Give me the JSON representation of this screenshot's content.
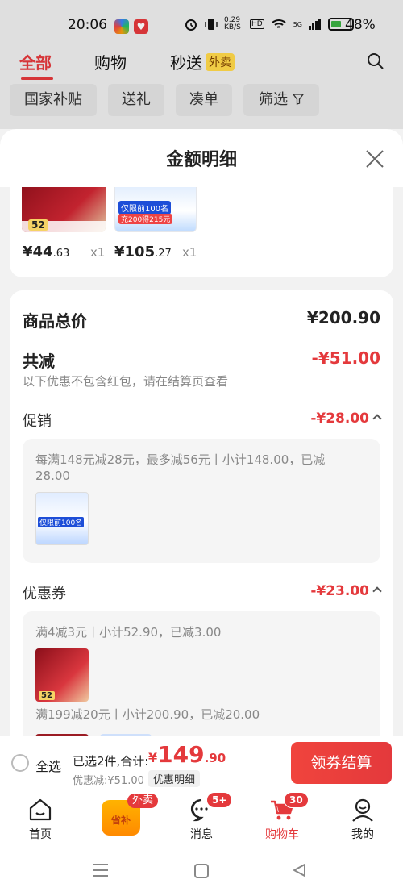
{
  "status_bar": {
    "time": "20:06",
    "network_speed": "0.29 KB/S",
    "hd": "HD",
    "signal": "5G",
    "battery_percent": "48%"
  },
  "header": {
    "tabs": [
      {
        "label": "全部",
        "active": true
      },
      {
        "label": "购物",
        "active": false
      },
      {
        "label": "秒送",
        "active": false,
        "badge": "外卖"
      }
    ],
    "filters": [
      "国家补贴",
      "送礼",
      "凑单",
      "筛选"
    ]
  },
  "sheet": {
    "title": "金额明细",
    "products": [
      {
        "price_int": "¥44",
        "price_dec": ".63",
        "qty": "x1",
        "badge": "52"
      },
      {
        "price_int": "¥105",
        "price_dec": ".27",
        "qty": "x1",
        "tag": "仅限前100名",
        "sub": "充200得215元"
      }
    ],
    "total_label": "商品总价",
    "total_value": "¥200.90",
    "reduce_label": "共减",
    "reduce_value": "-¥51.00",
    "reduce_note": "以下优惠不包含红包，请在结算页查看",
    "promo": {
      "label": "促销",
      "value": "-¥28.00",
      "line1": "每满148元减28元，最多减56元丨小计148.00，已减",
      "line2": "28.00",
      "thumb_tag": "仅限前100名"
    },
    "coupon": {
      "label": "优惠券",
      "value": "-¥23.00",
      "line1": "满4减3元丨小计52.90，已减3.00",
      "thumb_badge": "52",
      "line2": "满199减20元丨小计200.90，已减20.00"
    }
  },
  "checkout": {
    "select_all": "全选",
    "summary": "已选2件,合计:",
    "currency": "¥",
    "total_int": "149",
    "total_dec": ".90",
    "discount": "优惠减:¥51.00",
    "detail_button": "优惠明细",
    "checkout_button": "领券结算"
  },
  "bottom_nav": {
    "items": [
      {
        "label": "首页",
        "icon": "home-icon"
      },
      {
        "label": "",
        "icon": "subsidy-bag-icon",
        "bag_text": "省补",
        "badge": "外卖"
      },
      {
        "label": "消息",
        "icon": "message-icon",
        "badge": "5+"
      },
      {
        "label": "购物车",
        "icon": "cart-icon",
        "badge": "30",
        "active": true
      },
      {
        "label": "我的",
        "icon": "profile-icon"
      }
    ]
  },
  "colors": {
    "accent": "#e4393c",
    "background": "#f2f2f2"
  }
}
